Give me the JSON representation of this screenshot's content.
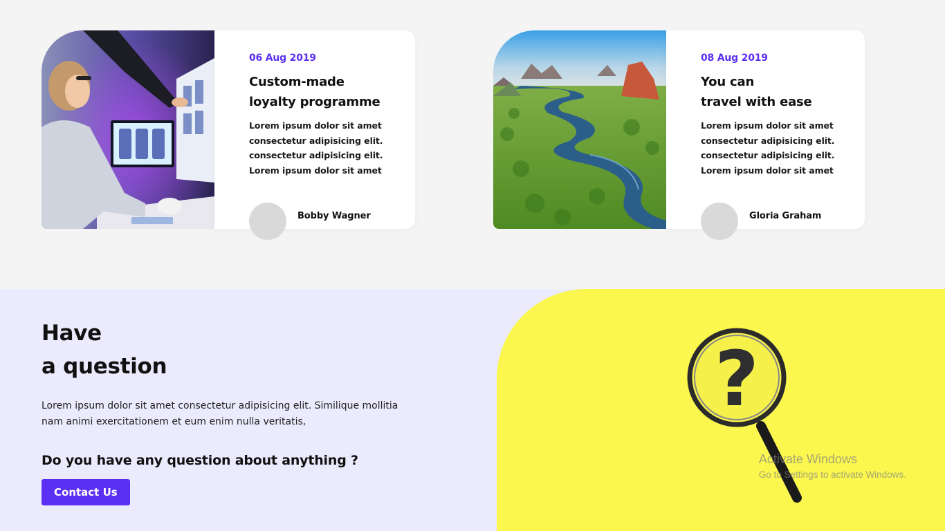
{
  "cards": [
    {
      "date": "06 Aug 2019",
      "title_line1": "Custom-made",
      "title_line2": "loyalty programme",
      "text": [
        "Lorem ipsum dolor sit amet",
        "consectetur adipisicing elit.",
        "consectetur adipisicing elit.",
        "Lorem ipsum dolor sit amet"
      ],
      "author": "Bobby Wagner",
      "image": "office-photo"
    },
    {
      "date": "08 Aug 2019",
      "title_line1": "You can",
      "title_line2": "travel with ease",
      "text": [
        "Lorem ipsum dolor sit amet",
        "consectetur adipisicing elit.",
        "consectetur adipisicing elit.",
        "Lorem ipsum dolor sit amet"
      ],
      "author": "Gloria Graham",
      "image": "river-landscape-photo"
    }
  ],
  "question": {
    "title_line1": "Have",
    "title_line2": "a question",
    "text_line1": "Lorem ipsum dolor sit amet consectetur adipisicing elit. Similique mollitia",
    "text_line2": "nam animi exercitationem et eum enim nulla veritatis,",
    "subheading": "Do you have any question about anything ?",
    "button_label": "Contact Us",
    "image": "magnifier-question-mark",
    "question_mark": "?"
  },
  "watermark": {
    "line1": "Activate Windows",
    "line2": "Go to Settings to activate Windows."
  },
  "colors": {
    "accent": "#5b2ff2",
    "section_bg": "#ebebfd",
    "yellow": "#fbf74e",
    "page_bg": "#f4f4f4"
  }
}
